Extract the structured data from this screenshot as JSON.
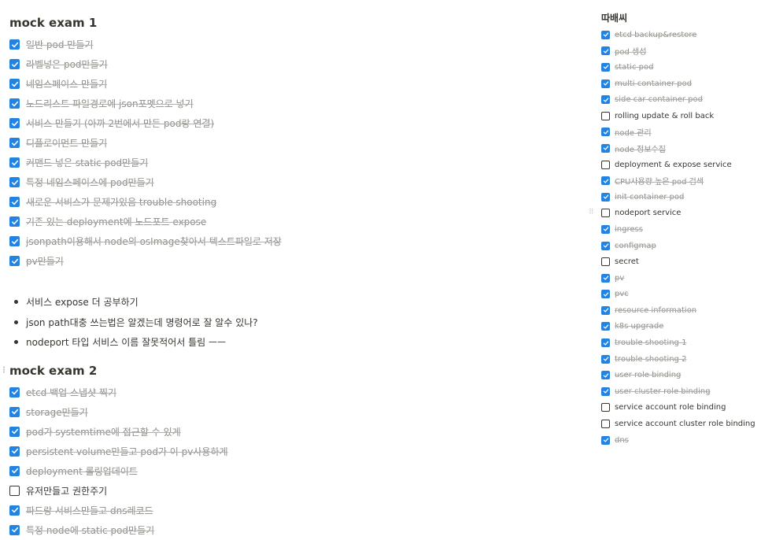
{
  "mock_exam_1": {
    "title": "mock exam 1",
    "todos": [
      {
        "text": "일반 pod 만들기",
        "checked": true
      },
      {
        "text": "라벨넣은 pod만들기",
        "checked": true
      },
      {
        "text": "네임스페이스 만들기",
        "checked": true
      },
      {
        "text": "노드리스트 파일경로에 json포멧으로 넣기",
        "checked": true
      },
      {
        "text": "서비스 만들기 (아까 2번에서 만든 pod랑 연결)",
        "checked": true
      },
      {
        "text": "디플로이먼트 만들기",
        "checked": true
      },
      {
        "text": "커맨드 넣은 static pod만들기",
        "checked": true
      },
      {
        "text": "특정 네임스페이스에 pod만들기",
        "checked": true
      },
      {
        "text": "새로운 서비스가 문제가있음 trouble shooting",
        "checked": true
      },
      {
        "text": "기존 있는 deployment에 노드포트 expose",
        "checked": true
      },
      {
        "text": "jsonpath이용해서 node의 osImage찾아서 텍스트파일로 저장",
        "checked": true
      },
      {
        "text": "pv만들기",
        "checked": true
      }
    ],
    "notes": [
      "서비스 expose 더 공부하기",
      "json path대충 쓰는법은 알겠는데 명령어로 잘 알수 있나?",
      "nodeport 타입 서비스 이름 잘못적어서 틀림 ㅡㅡ"
    ]
  },
  "mock_exam_2": {
    "title": "mock exam 2",
    "todos": [
      {
        "text": "etcd 백업 스냅샷 찍기",
        "checked": true
      },
      {
        "text": "storage만들기",
        "checked": true
      },
      {
        "text": "pod가 systemtime에 접근할 수 있게",
        "checked": true
      },
      {
        "text": "persistent volume만들고 pod가 이 pv사용하게",
        "checked": true
      },
      {
        "text": "deployment 롤링업데이트",
        "checked": true
      },
      {
        "text": "유저만들고 권한주기",
        "checked": false
      },
      {
        "text": "파드랑 서비스만들고 dns레코드",
        "checked": true
      },
      {
        "text": "특정 node에 static pod만들기",
        "checked": true
      }
    ]
  },
  "side_list": {
    "title": "따배씨",
    "todos": [
      {
        "text": "etcd backup&restore",
        "checked": true
      },
      {
        "text": "pod 생성",
        "checked": true
      },
      {
        "text": "static pod",
        "checked": true
      },
      {
        "text": "multi container pod",
        "checked": true
      },
      {
        "text": "side car container pod",
        "checked": true
      },
      {
        "text": "rolling update & roll back",
        "checked": false
      },
      {
        "text": "node 관리",
        "checked": true
      },
      {
        "text": "node 정보수집",
        "checked": true
      },
      {
        "text": "deployment & expose service",
        "checked": false
      },
      {
        "text": "CPU사용량 높은 pod 검색",
        "checked": true
      },
      {
        "text": "init container pod",
        "checked": true
      },
      {
        "text": "nodeport service",
        "checked": false
      },
      {
        "text": "ingress",
        "checked": true
      },
      {
        "text": "configmap",
        "checked": true
      },
      {
        "text": "secret",
        "checked": false
      },
      {
        "text": "pv",
        "checked": true
      },
      {
        "text": "pvc",
        "checked": true
      },
      {
        "text": "resource information",
        "checked": true
      },
      {
        "text": "k8s upgrade",
        "checked": true
      },
      {
        "text": "trouble shooting 1",
        "checked": true
      },
      {
        "text": "trouble shooting 2",
        "checked": true
      },
      {
        "text": "user role binding",
        "checked": true
      },
      {
        "text": "user cluster role binding",
        "checked": true
      },
      {
        "text": "service account role binding",
        "checked": false
      },
      {
        "text": "service account cluster role binding",
        "checked": false
      },
      {
        "text": "dns",
        "checked": true
      }
    ]
  },
  "icons": {
    "checkbox": "checkbox-icon",
    "drag_handle": "drag-handle-icon",
    "bullet": "bullet-icon"
  },
  "colors": {
    "checked_box": "#2383e2",
    "done_text": "#8f8d88",
    "text": "#37352f"
  }
}
